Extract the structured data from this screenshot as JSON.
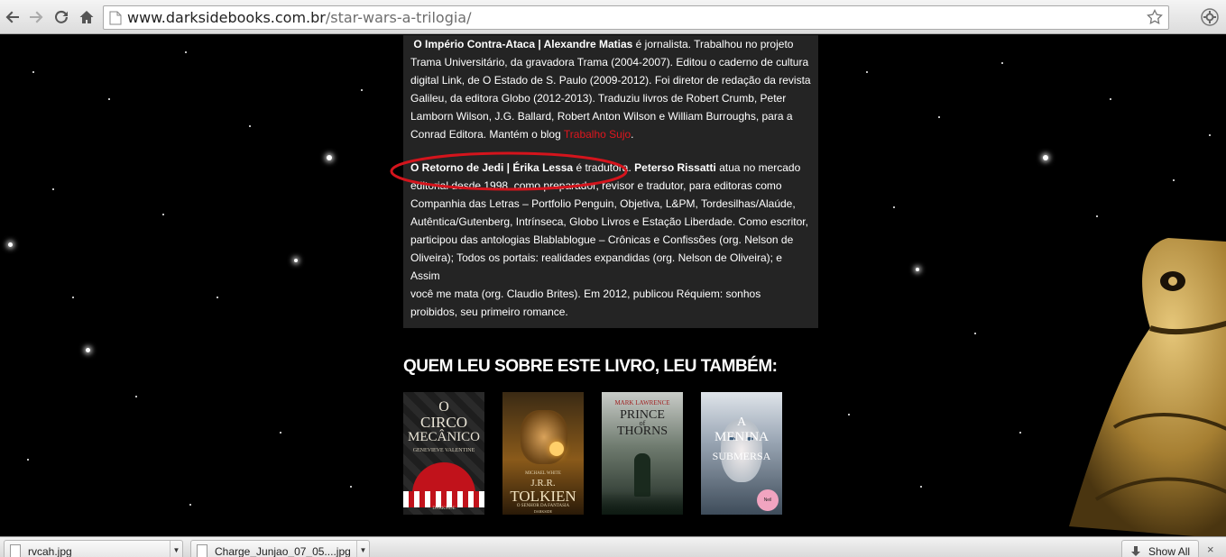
{
  "browser": {
    "url_domain": "www.darksidebooks.com.br",
    "url_path": "/star-wars-a-trilogia/",
    "icons": [
      "back-arrow-icon",
      "forward-arrow-icon",
      "reload-icon",
      "home-icon",
      "bookmark-star-icon",
      "settings-icon"
    ]
  },
  "article": {
    "p1_bold": "O Império Contra-Ataca | Alexandre Matias",
    "p1_lines": [
      "é jornalista. Trabalhou no projeto",
      "Trama Universitário, da gravadora Trama (2004-2007). Editou o caderno de cultura",
      "digital Link, de O Estado de S. Paulo (2009-2012). Foi diretor de redação da revista",
      "Galileu, da editora Globo (2012-2013). Traduziu livros de Robert Crumb, Peter",
      "Lamborn Wilson, J.G. Ballard, Robert Anton Wilson e William Burroughs, para a",
      "Conrad Editora. Mantém o blog"
    ],
    "p1_link": "Trabalho Sujo",
    "p1_end": ".",
    "p2_bold": "O Retorno de Jedi | Érika Lessa",
    "p2_mid": "é tradutora.",
    "p2_bold2": "Peterso Rissatti",
    "p2_first_rest": "atua no mercado",
    "p2_lines": [
      "editorial desde 1998, como preparador, revisor e tradutor, para editoras como",
      "Companhia das Letras – Portfolio Penguin, Objetiva, L&PM, Tordesilhas/Alaúde,",
      "Autêntica/Gutenberg, Intrínseca, Globo Livros e Estação Liberdade. Como escritor,",
      "participou das antologias Blablablogue – Crônicas e Confissões (org. Nelson de",
      "Oliveira); Todos os portais: realidades expandidas (org. Nelson de Oliveira); e Assim",
      "você me mata (org. Claudio Brites). Em 2012, publicou Réquiem: sonhos",
      "proibidos, seu primeiro romance."
    ]
  },
  "related": {
    "title": "QUEM LEU SOBRE ESTE LIVRO, LEU TAMBÉM:",
    "books": [
      {
        "t1": "O",
        "t2": "CIRCO",
        "t3": "MECÂNICO",
        "author": "GENEVIEVE VALENTINE",
        "publisher": "DARKSIDE"
      },
      {
        "author": "MICHAEL WHITE",
        "t1": "J.R.R.",
        "t2": "TOLKIEN",
        "t3": "O SENHOR DA FANTASIA",
        "publisher": "DARKSIDE"
      },
      {
        "author": "MARK LAWRENCE",
        "t1": "PRINCE",
        "t2": "of",
        "t3": "THORNS"
      },
      {
        "t1": "A",
        "t2": "MENINA",
        "t3": "SUBMERSA",
        "badge": "Neil Gaiman"
      }
    ]
  },
  "downloads": {
    "items": [
      {
        "name": "rvcah.jpg"
      },
      {
        "name": "Charge_Junjao_07_05....jpg"
      }
    ],
    "show_all": "Show All"
  }
}
